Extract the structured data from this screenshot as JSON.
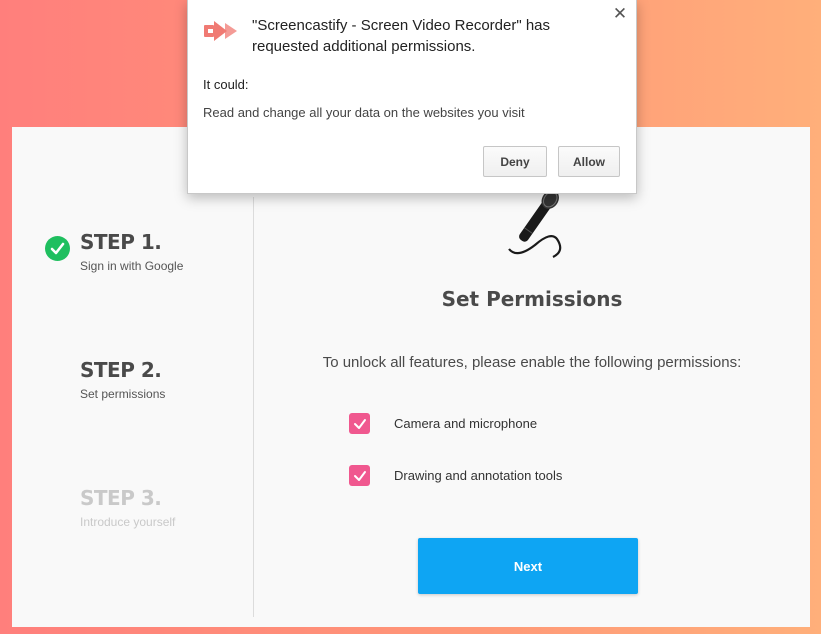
{
  "dialog": {
    "title": "\"Screencastify - Screen Video Recorder\" has requested additional permissions.",
    "could_label": "It could:",
    "permission_text": "Read and change all your data on the websites you visit",
    "deny_label": "Deny",
    "allow_label": "Allow",
    "close_symbol": "✕",
    "app_icon": "screencastify-logo-icon"
  },
  "steps": [
    {
      "title": "STEP 1.",
      "subtitle": "Sign in with Google",
      "status": "complete"
    },
    {
      "title": "STEP 2.",
      "subtitle": "Set permissions",
      "status": "active"
    },
    {
      "title": "STEP 3.",
      "subtitle": "Introduce yourself",
      "status": "upcoming"
    }
  ],
  "main": {
    "title": "Set Permissions",
    "intro": "To unlock all features, please enable the following permissions:",
    "permissions": [
      {
        "label": "Camera and microphone",
        "checked": true
      },
      {
        "label": "Drawing and annotation tools",
        "checked": true
      }
    ],
    "next_label": "Next"
  },
  "colors": {
    "accent_pink": "#f0588f",
    "next_blue": "#0ea5f3",
    "check_green": "#1fbf5f",
    "logo_red": "#f07a73"
  }
}
